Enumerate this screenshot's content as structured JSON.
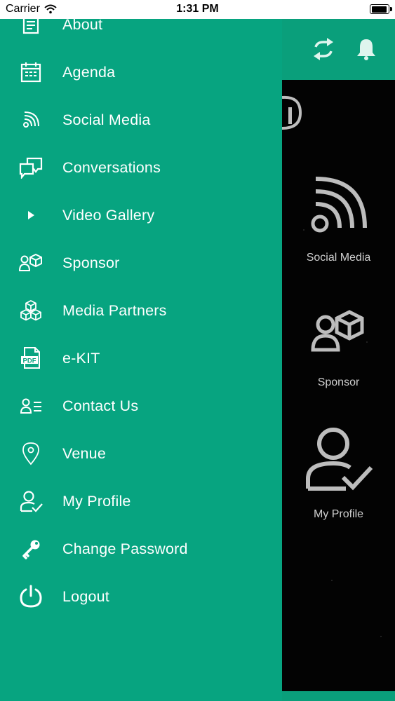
{
  "status_bar": {
    "carrier": "Carrier",
    "time": "1:31 PM",
    "battery_level": 0.95
  },
  "drawer": {
    "items": [
      {
        "label": "About",
        "icon": "document-icon"
      },
      {
        "label": "Agenda",
        "icon": "calendar-icon"
      },
      {
        "label": "Social Media",
        "icon": "rss-icon"
      },
      {
        "label": "Conversations",
        "icon": "chat-icon"
      },
      {
        "label": "Video Gallery",
        "icon": "play-icon"
      },
      {
        "label": "Sponsor",
        "icon": "person-cube-icon"
      },
      {
        "label": "Media Partners",
        "icon": "cubes-icon"
      },
      {
        "label": "e-KIT",
        "icon": "pdf-icon"
      },
      {
        "label": "Contact Us",
        "icon": "contact-card-icon"
      },
      {
        "label": "Venue",
        "icon": "location-pin-icon"
      },
      {
        "label": "My Profile",
        "icon": "user-check-icon"
      },
      {
        "label": "Change Password",
        "icon": "key-icon"
      },
      {
        "label": "Logout",
        "icon": "power-icon"
      }
    ]
  },
  "background_app": {
    "header_icons": [
      "sync-icon",
      "bell-icon"
    ],
    "tiles": [
      {
        "label": "Social Media",
        "icon": "rss-icon"
      },
      {
        "label": "Sponsor",
        "icon": "person-cube-icon"
      },
      {
        "label": "My Profile",
        "icon": "user-check-icon"
      }
    ]
  },
  "colors": {
    "drawer_bg": "#07a480",
    "header_bg": "#0a9f7b",
    "app_bg": "#030303",
    "tile_text": "#cfcfcf"
  }
}
